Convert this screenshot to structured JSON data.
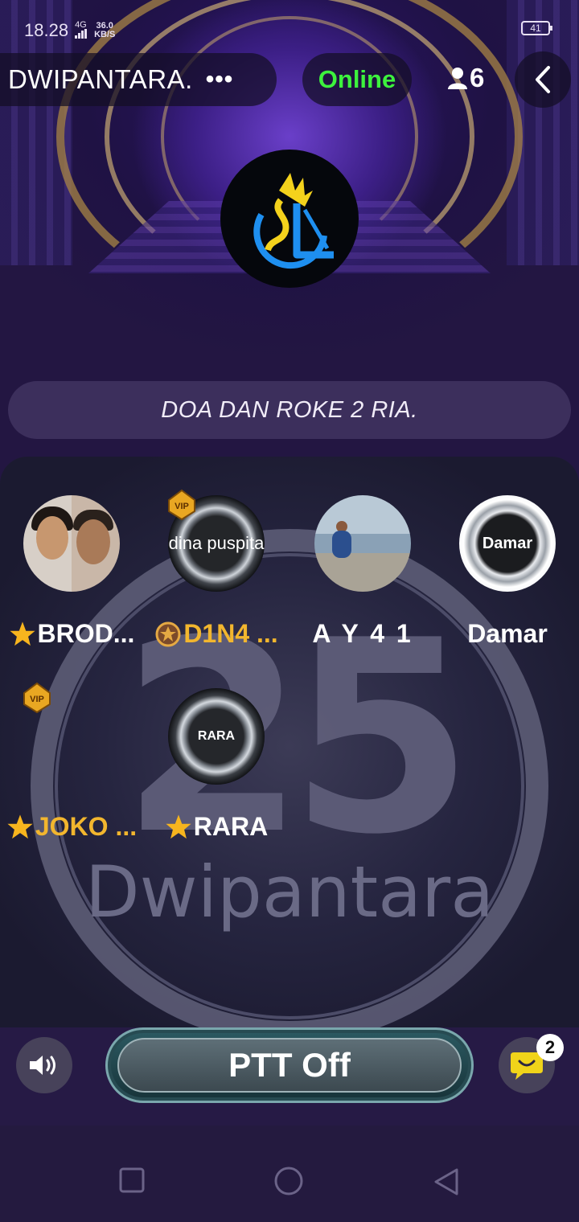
{
  "status_bar": {
    "time": "18.28",
    "network": "4G",
    "speed_value": "36.0",
    "speed_unit": "KB/S",
    "battery": "41"
  },
  "header": {
    "room_title": "DWIPANTARA.",
    "more_label": "•••",
    "status": "Online",
    "member_count": "6",
    "icons": [
      "more-dots-icon",
      "person-icon",
      "back-chevron-icon"
    ]
  },
  "announcement": "DOA DAN ROKE 2 RIA.",
  "background": {
    "big_number": "25",
    "brand_text": "Dwipantara"
  },
  "seats": [
    {
      "name": "BROD...",
      "badge": "star",
      "vip": false,
      "avatar_text": ""
    },
    {
      "name": "D1N4 ...",
      "badge": "medal",
      "vip": true,
      "avatar_text": "dina puspita"
    },
    {
      "name": "A Y 4 1",
      "badge": "",
      "vip": false,
      "avatar_text": ""
    },
    {
      "name": "Damar",
      "badge": "",
      "vip": false,
      "avatar_text": "Damar"
    },
    {
      "name": "JOKO ...",
      "badge": "star",
      "vip": true,
      "avatar_text": ""
    },
    {
      "name": "RARA",
      "badge": "star",
      "vip": false,
      "avatar_text": "RARA"
    }
  ],
  "controls": {
    "ptt_label": "PTT Off",
    "chat_badge": "2"
  },
  "colors": {
    "online": "#3df23d",
    "gold_name": "#f2b62e",
    "white_name": "#ffffff",
    "accent_blue": "#1e8ff0"
  }
}
